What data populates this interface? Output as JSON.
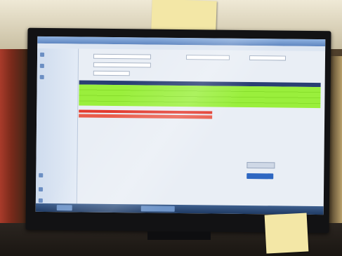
{
  "note_top": {
    "lines": []
  },
  "note_bottom": {
    "lines": []
  },
  "app": {
    "title": "",
    "menu": []
  },
  "sidebar": {
    "items": [
      "",
      "",
      "",
      "",
      "",
      "",
      "",
      "",
      "",
      "",
      "",
      ""
    ]
  },
  "table": {
    "highlight_color": "#9aef3c",
    "alert_color": "#e23a2e",
    "header_color": "#2a3f73"
  },
  "taskbar": {
    "color": "#1f3a63",
    "tray": ""
  }
}
